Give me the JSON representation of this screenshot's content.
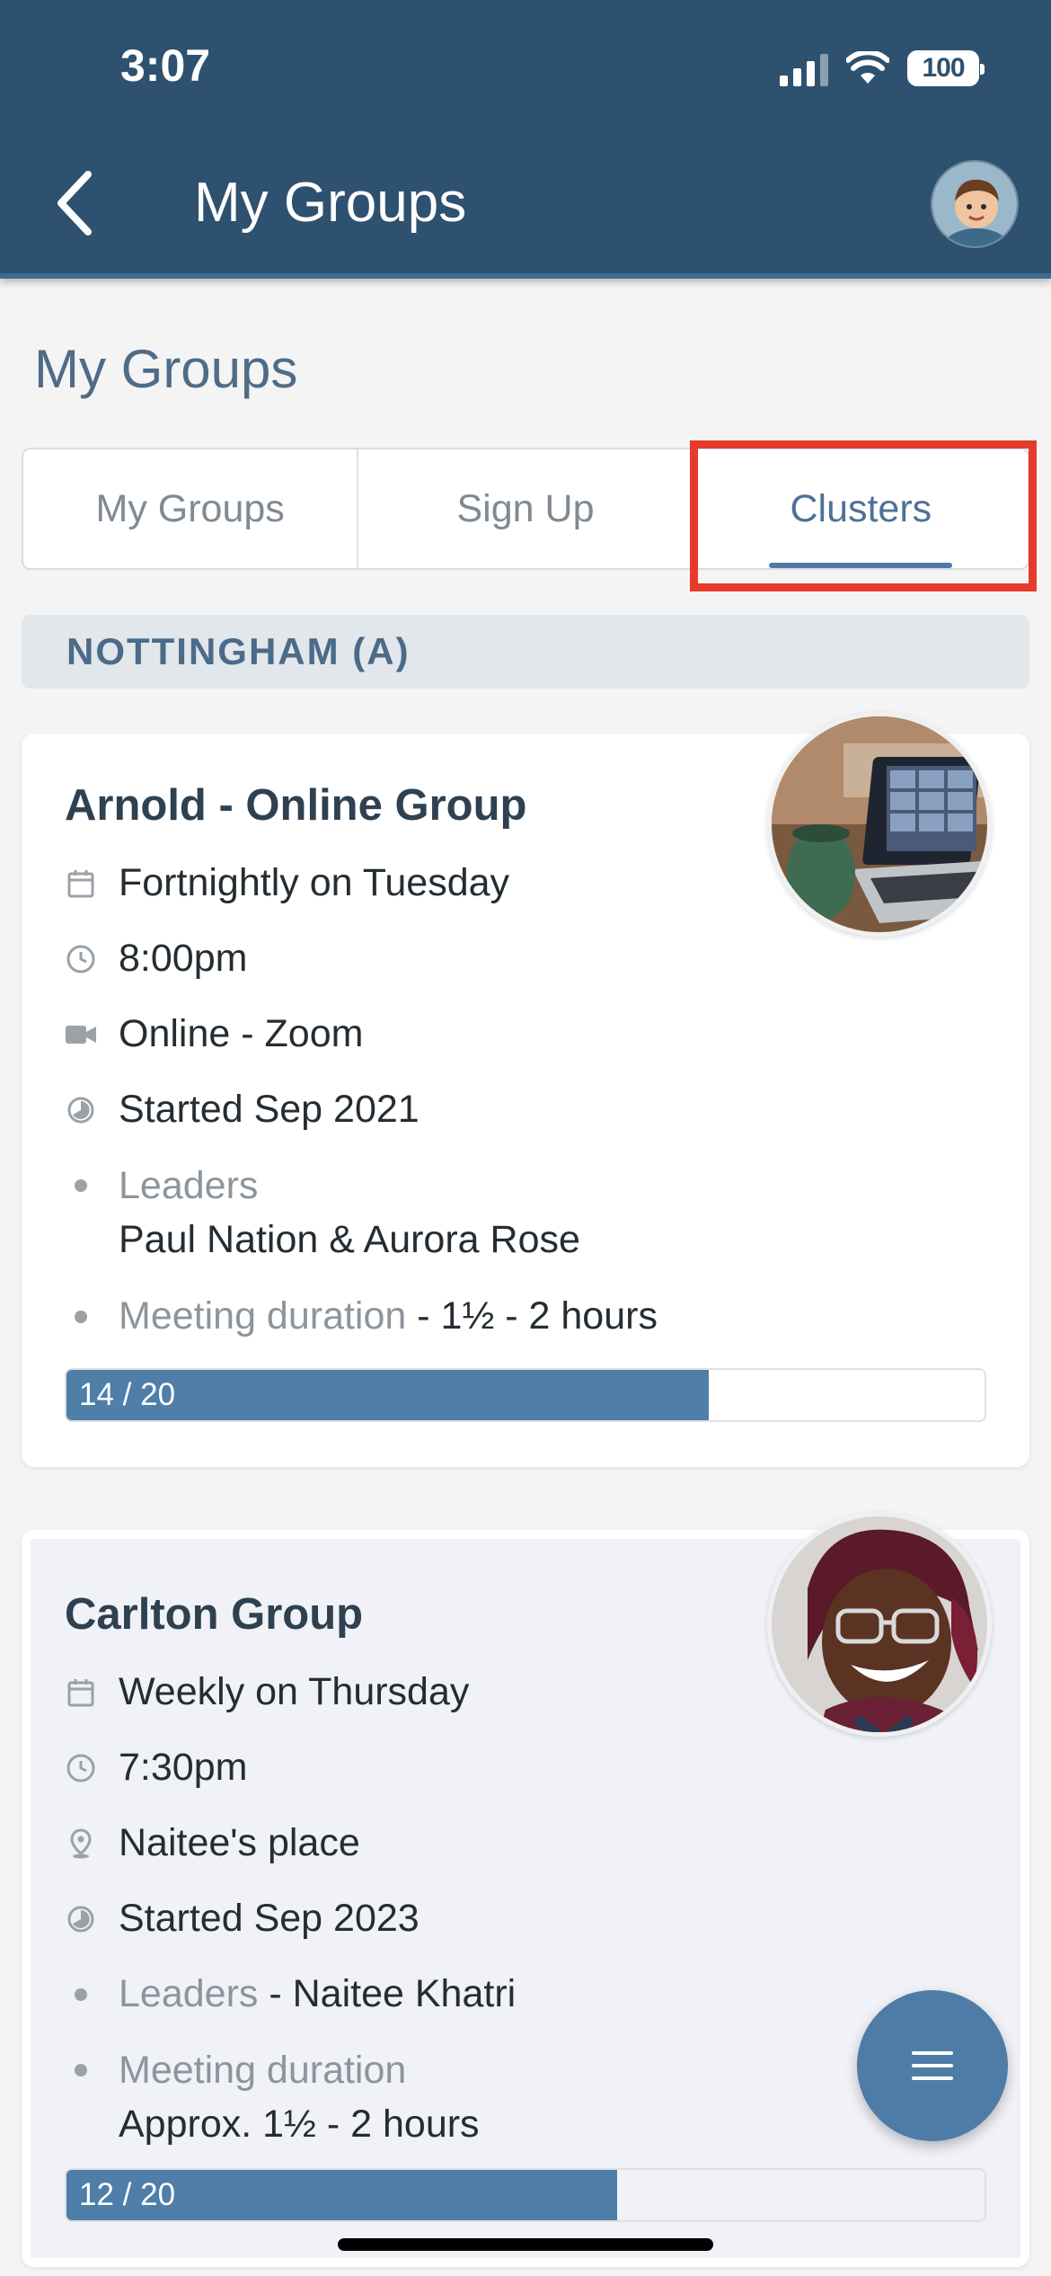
{
  "status_bar": {
    "time": "3:07",
    "battery": "100"
  },
  "header": {
    "title": "My Groups"
  },
  "page": {
    "title": "My Groups"
  },
  "tabs": [
    {
      "label": "My Groups",
      "active": false
    },
    {
      "label": "Sign Up",
      "active": false
    },
    {
      "label": "Clusters",
      "active": true
    }
  ],
  "section": {
    "title": "NOTTINGHAM (A)"
  },
  "groups": [
    {
      "title": "Arnold - Online Group",
      "schedule": "Fortnightly on Tuesday",
      "time": "8:00pm",
      "location": "Online - Zoom",
      "started": "Started Sep 2021",
      "leaders_label": "Leaders",
      "leaders": "Paul Nation & Aurora Rose",
      "duration_label": "Meeting duration",
      "duration": " - 1½ - 2 hours",
      "capacity": "14 / 20",
      "filled": 14,
      "total": 20
    },
    {
      "title": "Carlton Group",
      "schedule": "Weekly on Thursday",
      "time": "7:30pm",
      "location": "Naitee's place",
      "started": "Started Sep 2023",
      "leaders_label": "Leaders",
      "leaders": " - Naitee Khatri",
      "duration_label": "Meeting duration",
      "duration": "Approx. 1½ - 2 hours",
      "capacity": "12 / 20",
      "filled": 12,
      "total": 20
    }
  ],
  "colors": {
    "header": "#2e5170",
    "accent": "#4f7ea8",
    "highlight": "#e63b2a"
  },
  "icons": [
    "back-chevron-icon",
    "calendar-icon",
    "clock-icon",
    "video-icon",
    "location-pin-icon",
    "pie-icon",
    "menu-icon"
  ]
}
